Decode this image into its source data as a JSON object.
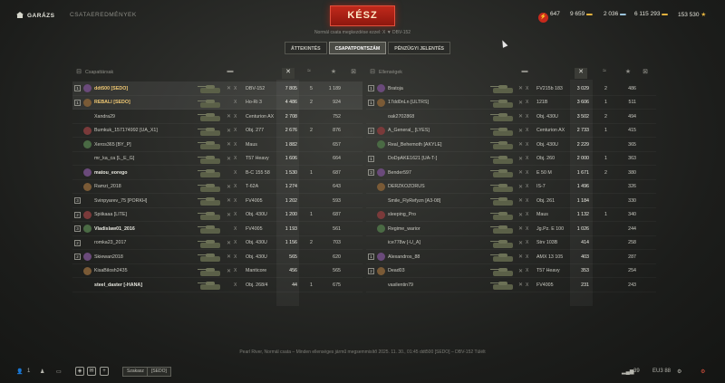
{
  "nav": {
    "garage": "GARÁZS",
    "results": "CSATAEREDMÉNYEK"
  },
  "ready_button": "KÉSZ",
  "battle_mode_info": "Normál csata megkezdése ezzel:  X  ▼  DBV-152",
  "currency": {
    "gold_badge": "⚡",
    "gold": "647",
    "silver": "9 659",
    "free_xp": "2 036",
    "credits": "6 115 293",
    "bonds": "153 530"
  },
  "tabs": [
    "ÁTTEKINTÉS",
    "CSAPATPONTSZÁM",
    "PÉNZÜGYI JELENTÉS"
  ],
  "team_header": {
    "allies": "Csapattársak",
    "enemies": "Ellenségek"
  },
  "allies": [
    {
      "plat": "1",
      "name": "ddt500 [SEDO]",
      "me": true,
      "dead": "✕",
      "tier": "X",
      "vehicle": "DBV-152",
      "damage": "7 805",
      "kills": "5",
      "xp": "1 189",
      "hl": true
    },
    {
      "plat": "1",
      "name": "REBALI [SEDO]",
      "me": true,
      "dead": "",
      "tier": "X",
      "vehicle": "Ho-Ri 3",
      "damage": "4 486",
      "kills": "2",
      "xp": "924",
      "hl": true
    },
    {
      "plat": "",
      "name": "Xandra29",
      "dead": "✕",
      "tier": "X",
      "vehicle": "Centurion AX",
      "damage": "2 708",
      "kills": "",
      "xp": "752"
    },
    {
      "plat": "",
      "name": "Bumkuk_157174992 [UA_X1]",
      "dead": "✕",
      "tier": "X",
      "vehicle": "Obj. 277",
      "damage": "2 676",
      "kills": "2",
      "xp": "876"
    },
    {
      "plat": "",
      "name": "Xeros365 [BY_P]",
      "dead": "✕",
      "tier": "X",
      "vehicle": "Maus",
      "damage": "1 882",
      "kills": "",
      "xp": "657"
    },
    {
      "plat": "",
      "name": "mr_ka_ca [L_E_G]",
      "dead": "✕",
      "tier": "X",
      "vehicle": "T57 Heavy",
      "damage": "1 606",
      "kills": "",
      "xp": "664"
    },
    {
      "plat": "",
      "name": "matou_eorego",
      "dead": "",
      "tier": "X",
      "vehicle": "B-C 155 58",
      "damage": "1 530",
      "kills": "1",
      "xp": "687",
      "bold": true
    },
    {
      "plat": "",
      "name": "Ramzi_2018",
      "dead": "✕",
      "tier": "X",
      "vehicle": "T-62A",
      "damage": "1 274",
      "kills": "",
      "xp": "643"
    },
    {
      "plat": "3",
      "name": "Svinpyarev_75 [PORKH]",
      "dead": "✕",
      "tier": "X",
      "vehicle": "FV4005",
      "damage": "1 202",
      "kills": "",
      "xp": "593"
    },
    {
      "plat": "2",
      "name": "Spiikaaa [LITE]",
      "dead": "✕",
      "tier": "X",
      "vehicle": "Obj. 430U",
      "damage": "1 200",
      "kills": "1",
      "xp": "687"
    },
    {
      "plat": "3",
      "name": "Vladislaw01_2016",
      "dead": "",
      "tier": "X",
      "vehicle": "FV4005",
      "damage": "1 193",
      "kills": "",
      "xp": "561",
      "bold": true
    },
    {
      "plat": "2",
      "name": "romka23_2017",
      "dead": "✕",
      "tier": "X",
      "vehicle": "Obj. 430U",
      "damage": "1 156",
      "kills": "2",
      "xp": "703"
    },
    {
      "plat": "2",
      "name": "Skiewan2018",
      "dead": "✕",
      "tier": "X",
      "vehicle": "Obj. 430U",
      "damage": "565",
      "kills": "",
      "xp": "620"
    },
    {
      "plat": "",
      "name": "KisaBilosh2435",
      "dead": "✕",
      "tier": "X",
      "vehicle": "Manticore",
      "damage": "456",
      "kills": "",
      "xp": "565"
    },
    {
      "plat": "",
      "name": "steel_daster [-HANA]",
      "dead": "",
      "tier": "X",
      "vehicle": "Obj. 268/4",
      "damage": "44",
      "kills": "1",
      "xp": "675",
      "bold": true
    }
  ],
  "enemies": [
    {
      "plat": "1",
      "name": "Bratoja",
      "dead": "✕",
      "tier": "X",
      "vehicle": "FV215b 183",
      "damage": "3 029",
      "kills": "2",
      "xp": "486"
    },
    {
      "plat": "1",
      "name": "17dd0nLn [ULTRS]",
      "dead": "✕",
      "tier": "X",
      "vehicle": "121B",
      "damage": "3 606",
      "kills": "1",
      "xp": "511"
    },
    {
      "plat": "",
      "name": "oak2702868",
      "dead": "✕",
      "tier": "X",
      "vehicle": "Obj. 430U",
      "damage": "3 502",
      "kills": "2",
      "xp": "494"
    },
    {
      "plat": "3",
      "name": "A_General_ [LYES]",
      "dead": "✕",
      "tier": "X",
      "vehicle": "Centurion AX",
      "damage": "2 733",
      "kills": "1",
      "xp": "415"
    },
    {
      "plat": "",
      "name": "Real_Behemoth [AKYLE]",
      "dead": "✕",
      "tier": "X",
      "vehicle": "Obj. 430U",
      "damage": "2 229",
      "kills": "",
      "xp": "365"
    },
    {
      "plat": "1",
      "name": "DoDpAKE1621 [UA-T-]",
      "dead": "✕",
      "tier": "X",
      "vehicle": "Obj. 260",
      "damage": "2 000",
      "kills": "1",
      "xp": "363"
    },
    {
      "plat": "3",
      "name": "Bender597",
      "dead": "✕",
      "tier": "X",
      "vehicle": "E 50 M",
      "damage": "1 671",
      "kills": "2",
      "xp": "380"
    },
    {
      "plat": "",
      "name": "DERZKOZORUS",
      "dead": "✕",
      "tier": "X",
      "vehicle": "IS-7",
      "damage": "1 496",
      "kills": "",
      "xp": "326"
    },
    {
      "plat": "",
      "name": "Smile_FlyRefyzn [A3-08]",
      "dead": "✕",
      "tier": "X",
      "vehicle": "Obj. 261",
      "damage": "1 184",
      "kills": "",
      "xp": "330"
    },
    {
      "plat": "",
      "name": "sleeping_Pro",
      "dead": "✕",
      "tier": "X",
      "vehicle": "Maus",
      "damage": "1 132",
      "kills": "1",
      "xp": "340"
    },
    {
      "plat": "",
      "name": "Regime_warior",
      "dead": "✕",
      "tier": "X",
      "vehicle": "Jg.Pz. E 100",
      "damage": "1 026",
      "kills": "",
      "xp": "244"
    },
    {
      "plat": "",
      "name": "ice778w [-U_A]",
      "dead": "✕",
      "tier": "X",
      "vehicle": "Strv 103B",
      "damage": "414",
      "kills": "",
      "xp": "258"
    },
    {
      "plat": "1",
      "name": "Alexandros_88",
      "dead": "✕",
      "tier": "X",
      "vehicle": "AMX 13 105",
      "damage": "403",
      "kills": "",
      "xp": "287"
    },
    {
      "plat": "2",
      "name": "Dead03",
      "dead": "✕",
      "tier": "X",
      "vehicle": "T57 Heavy",
      "damage": "353",
      "kills": "",
      "xp": "254"
    },
    {
      "plat": "",
      "name": "vasilentin79",
      "dead": "✕",
      "tier": "X",
      "vehicle": "FV4005",
      "damage": "231",
      "kills": "",
      "xp": "243"
    }
  ],
  "footer_info": "Pearl River, Normál csata – Minden ellenséges jármű megsemmisítő   2025. 11. 30., 01:45   ddt500 [SEDO] – DBV-152   Túlélt",
  "bottom": {
    "friends_count": "1",
    "squad_label": "Szakasz",
    "clan_label": "[SEDO]",
    "ping": "39",
    "server": "EU3 88"
  }
}
